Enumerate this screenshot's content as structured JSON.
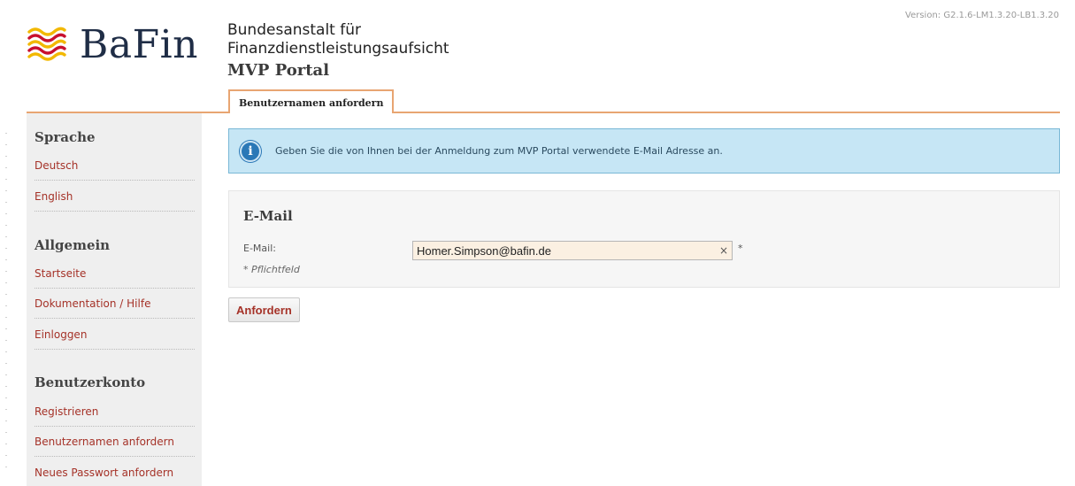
{
  "header": {
    "logo_text": "BaFin",
    "agency_line1": "Bundesanstalt für",
    "agency_line2": "Finanzdienstleistungsaufsicht",
    "portal_name": "MVP Portal",
    "version": "Version: G2.1.6-LM1.3.20-LB1.3.20"
  },
  "tabs": [
    {
      "label": "Benutzernamen anfordern",
      "active": true
    }
  ],
  "sidebar": {
    "sections": [
      {
        "title": "Sprache",
        "items": [
          {
            "label": "Deutsch"
          },
          {
            "label": "English"
          }
        ]
      },
      {
        "title": "Allgemein",
        "items": [
          {
            "label": "Startseite"
          },
          {
            "label": "Dokumentation / Hilfe"
          },
          {
            "label": "Einloggen"
          }
        ]
      },
      {
        "title": "Benutzerkonto",
        "items": [
          {
            "label": "Registrieren"
          },
          {
            "label": "Benutzernamen anfordern"
          },
          {
            "label": "Neues Passwort anfordern"
          }
        ]
      }
    ]
  },
  "info": {
    "icon": "info-icon",
    "icon_glyph": "i",
    "text": "Geben Sie die von Ihnen bei der Anmeldung zum MVP Portal verwendete E-Mail Adresse an."
  },
  "form": {
    "title": "E-Mail",
    "email_label": "E-Mail:",
    "email_value": "Homer.Simpson@bafin.de",
    "clear_glyph": "×",
    "required_marker": "*",
    "required_note": "* Pflichtfeld",
    "submit_label": "Anfordern"
  },
  "colors": {
    "accent_orange": "#e8a572",
    "link_red": "#a53228",
    "info_bg": "#c6e6f5",
    "info_border": "#79b8d6",
    "sidebar_bg": "#efefef",
    "logo_navy": "#1f2d46",
    "logo_red": "#c8102e",
    "logo_yellow": "#f2b800"
  }
}
